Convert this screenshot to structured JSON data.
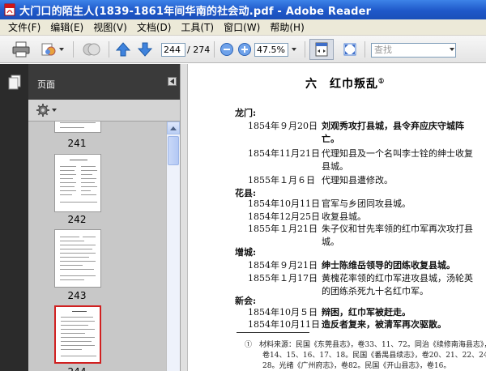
{
  "window": {
    "title": "大门口的陌生人(1839-1861年间华南的社会动.pdf - Adobe Reader",
    "icon": "pdf-app-icon"
  },
  "menu": [
    "文件(F)",
    "编辑(E)",
    "视图(V)",
    "文档(D)",
    "工具(T)",
    "窗口(W)",
    "帮助(H)"
  ],
  "toolbar": {
    "current_page": "244",
    "total_pages": "/ 274",
    "zoom": "47.5%",
    "find_placeholder": "查找"
  },
  "pages_panel": {
    "title": "页面",
    "thumbnails": [
      {
        "label": "241"
      },
      {
        "label": "242"
      },
      {
        "label": "243"
      },
      {
        "label": "244",
        "selected": true
      }
    ]
  },
  "document": {
    "heading": "六　红巾叛乱",
    "heading_note": "①",
    "sections": [
      {
        "place": "龙门:",
        "entries": [
          {
            "date": "1854年９月20日",
            "text": "刘观秀攻打县城，县令弃应庆守城阵",
            "cont": "亡。"
          },
          {
            "date": "1854年11月21日",
            "text": "代理知县及一个名叫李士铨的绅士收复",
            "cont": "县城。"
          },
          {
            "date": "1855年１月６日",
            "text": "代理知县遭修改。",
            "cont": ""
          }
        ]
      },
      {
        "place": "花县:",
        "entries": [
          {
            "date": "1854年10月11日",
            "text": "官军与乡团同攻县城。",
            "cont": ""
          },
          {
            "date": "1854年12月25日",
            "text": "收复县城。",
            "cont": ""
          },
          {
            "date": "1855年１月21日",
            "text": "朱子仪和甘先率领的红巾军再次攻打县",
            "cont": "城。"
          }
        ]
      },
      {
        "place": "增城:",
        "entries": [
          {
            "date": "1854年９月21日",
            "text": "绅士陈维岳领导的团练收复县城。",
            "cont": ""
          },
          {
            "date": "1855年１月17日",
            "text": "黄槐花率领的红巾军进攻县城，汤轮英",
            "cont": "的团练杀死九十名红巾军。"
          }
        ]
      },
      {
        "place": "新会:",
        "entries": [
          {
            "date": "1854年10月５日",
            "text": "辩困，红巾军被赶走。",
            "cont": ""
          },
          {
            "date": "1854年10月11日",
            "text": "造反者复来，被清军再次驱散。",
            "cont": ""
          }
        ]
      }
    ],
    "footnote_1": "①　材料来源：民国《东莞县志》，卷33、11、72。同治《续修南海县志》，",
    "footnote_2": "卷14、15、16、17、18。民国《番禺县续志》，卷20、21、22、24、",
    "footnote_3": "28。光绪《广州府志》，卷82。民国《开山县志》，卷16。"
  }
}
